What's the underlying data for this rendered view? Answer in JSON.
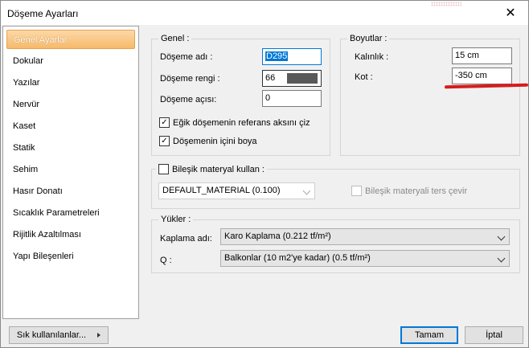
{
  "window": {
    "title": "Döşeme Ayarları"
  },
  "sidebar": {
    "items": [
      {
        "label": "Genel Ayarlar"
      },
      {
        "label": "Dokular"
      },
      {
        "label": "Yazılar"
      },
      {
        "label": "Nervür"
      },
      {
        "label": "Kaset"
      },
      {
        "label": "Statik"
      },
      {
        "label": "Sehim"
      },
      {
        "label": "Hasır Donatı"
      },
      {
        "label": "Sıcaklık Parametreleri"
      },
      {
        "label": "Rijitlik Azaltılması"
      },
      {
        "label": "Yapı Bileşenleri"
      }
    ],
    "active_index": 0
  },
  "genel": {
    "title": "Genel :",
    "name_label": "Döşeme adı :",
    "name_value": "D295",
    "color_label": "Döşeme rengi :",
    "color_value": "66",
    "color_swatch": "#595959",
    "angle_label": "Döşeme açısı:",
    "angle_value": "0",
    "check1_label": "Eğik döşemenin referans aksını çiz",
    "check1_checked": true,
    "check2_label": "Döşemenin içini boya",
    "check2_checked": true
  },
  "boyutlar": {
    "title": "Boyutlar :",
    "thickness_label": "Kalınlık :",
    "thickness_value": "15 cm",
    "kot_label": "Kot :",
    "kot_value": "-350 cm"
  },
  "composite": {
    "checkbox_label": "Bileşik materyal kullan :",
    "material_value": "DEFAULT_MATERIAL (0.100)",
    "reverse_label": "Bileşik materyali ters çevir"
  },
  "loads": {
    "title": "Yükler :",
    "coating_label": "Kaplama adı:",
    "coating_value": "Karo Kaplama (0.212 tf/m²)",
    "q_label": "Q :",
    "q_value": "Balkonlar (10 m2'ye kadar) (0.5 tf/m²)"
  },
  "footer": {
    "frequent_label": "Sık kullanılanlar...",
    "ok_label": "Tamam",
    "cancel_label": "İptal"
  },
  "colors": {
    "accent": "#0078d7",
    "active_item": "#f6b96a",
    "highlight_line": "#d81b1b"
  }
}
